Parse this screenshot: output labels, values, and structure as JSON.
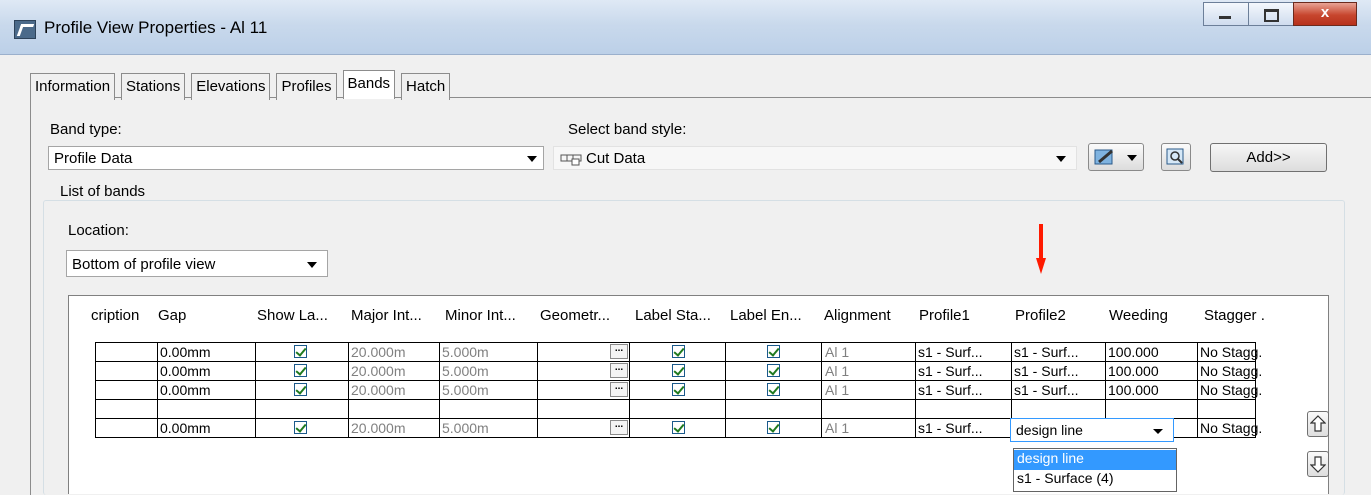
{
  "window": {
    "title": "Profile View Properties - Al 11",
    "min_icon": "minimize-icon",
    "max_icon": "maximize-icon",
    "close_glyph": "x"
  },
  "tabs": [
    {
      "label": "Information"
    },
    {
      "label": "Stations"
    },
    {
      "label": "Elevations"
    },
    {
      "label": "Profiles"
    },
    {
      "label": "Bands",
      "active": true
    },
    {
      "label": "Hatch"
    }
  ],
  "band_type": {
    "label": "Band type:",
    "value": "Profile Data"
  },
  "band_style": {
    "label": "Select band style:",
    "value": "Cut Data"
  },
  "add_button": {
    "label": "Add>>"
  },
  "list_of_bands": {
    "title": "List of bands",
    "location": {
      "label": "Location:",
      "value": "Bottom of profile view"
    }
  },
  "grid": {
    "columns": [
      "cription",
      "Gap",
      "Show La...",
      "Major Int...",
      "Minor Int...",
      "Geometr...",
      "Label Sta...",
      "Label En...",
      "Alignment",
      "Profile1",
      "Profile2",
      "Weeding",
      "Stagger ."
    ],
    "rows": [
      {
        "gap": "0.00mm",
        "major": "20.000m",
        "minor": "5.000m",
        "alignment": "Al 1",
        "profile1": "s1 - Surf...",
        "profile2": "s1 - Surf...",
        "weeding": "100.000",
        "stagger": "No Stagg."
      },
      {
        "gap": "0.00mm",
        "major": "20.000m",
        "minor": "5.000m",
        "alignment": "Al 1",
        "profile1": "s1 - Surf...",
        "profile2": "s1 - Surf...",
        "weeding": "100.000",
        "stagger": "No Stagg."
      },
      {
        "gap": "0.00mm",
        "major": "20.000m",
        "minor": "5.000m",
        "alignment": "Al 1",
        "profile1": "s1 - Surf...",
        "profile2": "s1 - Surf...",
        "weeding": "100.000",
        "stagger": "No Stagg."
      },
      {
        "gap": "0.00mm",
        "major": "20.000m",
        "minor": "5.000m",
        "alignment": "Al 1",
        "profile1": "s1 - Surf...",
        "profile2": "",
        "weeding": "",
        "stagger": "No Stagg."
      }
    ],
    "ellipsis": "...",
    "profile2_dropdown": {
      "value": "design line",
      "options": [
        "design line",
        "s1 - Surface (4)"
      ],
      "selected_index": 0
    }
  },
  "colors": {
    "accent_arrow": "#ff1a00",
    "selection": "#3399ff"
  }
}
